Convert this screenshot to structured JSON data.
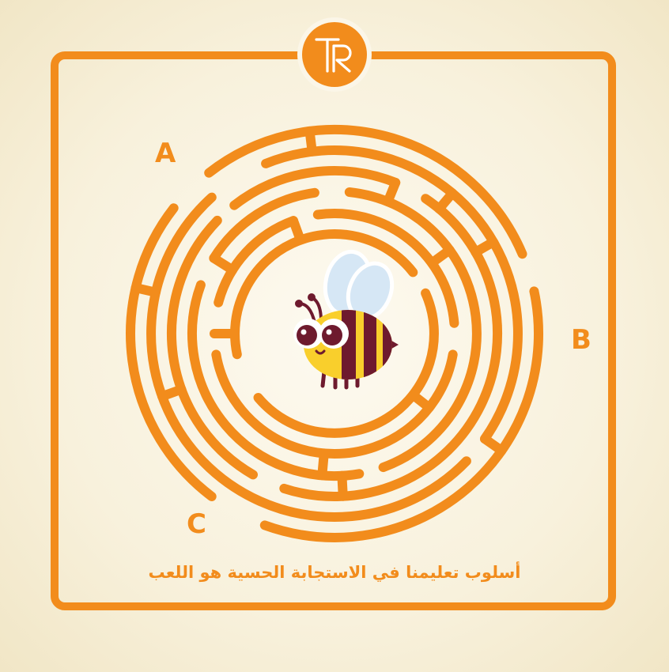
{
  "game": {
    "exits": {
      "a": "A",
      "b": "B",
      "c": "C"
    },
    "caption": "أسلوب تعليمنا في الاستجابة الحسية هو اللعب",
    "logo_text": "TR"
  },
  "colors": {
    "maze": "#f28c1c",
    "background": "#f8f1dc",
    "bee_yellow": "#f9cf2c",
    "bee_stripe": "#6e1a2e",
    "bee_wing": "#d6e7f5"
  },
  "icons": {
    "logo": "tr-monogram-icon",
    "character": "bee-icon"
  }
}
